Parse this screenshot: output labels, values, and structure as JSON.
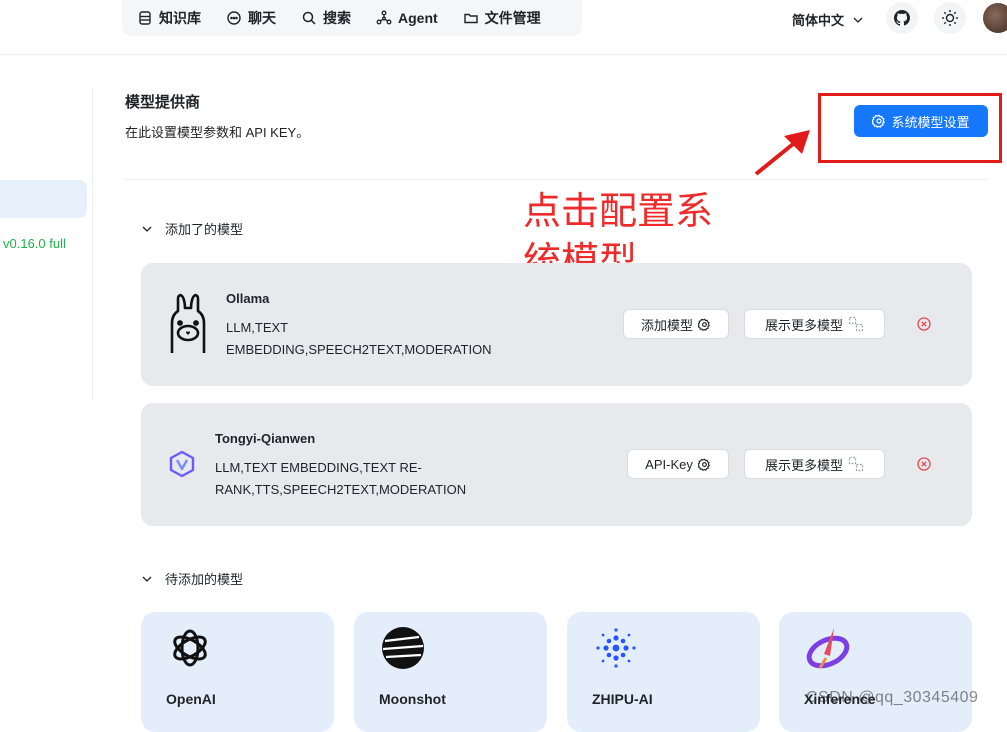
{
  "nav": {
    "items": [
      {
        "label": "知识库",
        "icon": "database-icon"
      },
      {
        "label": "聊天",
        "icon": "chat-icon"
      },
      {
        "label": "搜索",
        "icon": "search-icon"
      },
      {
        "label": "Agent",
        "icon": "agent-graph-icon"
      },
      {
        "label": "文件管理",
        "icon": "folder-icon"
      }
    ],
    "language": "简体中文"
  },
  "sidebar": {
    "version": "v0.16.0 full"
  },
  "header": {
    "title": "模型提供商",
    "subtitle": "在此设置模型参数和 API KEY。",
    "system_settings_label": "系统模型设置"
  },
  "annotation": {
    "text": "点击配置系统模型",
    "color": "#ee2a2a"
  },
  "added_section": {
    "label": "添加了的模型",
    "cards": [
      {
        "name": "Ollama",
        "tags_line1": "LLM,TEXT",
        "tags_line2": "EMBEDDING,SPEECH2TEXT,MODERATION",
        "primary_label": "添加模型",
        "secondary_label": "展示更多模型"
      },
      {
        "name": "Tongyi-Qianwen",
        "tags_line1": "LLM,TEXT EMBEDDING,TEXT RE-",
        "tags_line2": "RANK,TTS,SPEECH2TEXT,MODERATION",
        "primary_label": "API-Key",
        "secondary_label": "展示更多模型"
      }
    ]
  },
  "pending_section": {
    "label": "待添加的模型",
    "providers": [
      {
        "name": "OpenAI"
      },
      {
        "name": "Moonshot"
      },
      {
        "name": "ZHIPU-AI"
      },
      {
        "name": "Xinference"
      }
    ]
  },
  "watermark": "CSDN @qq_30345409",
  "colors": {
    "accent": "#1677ff",
    "version_green": "#21b24b",
    "annotation_red": "#ee2a2a",
    "card_bg": "#e8e9ec",
    "provider_bg": "#e4eefb"
  }
}
